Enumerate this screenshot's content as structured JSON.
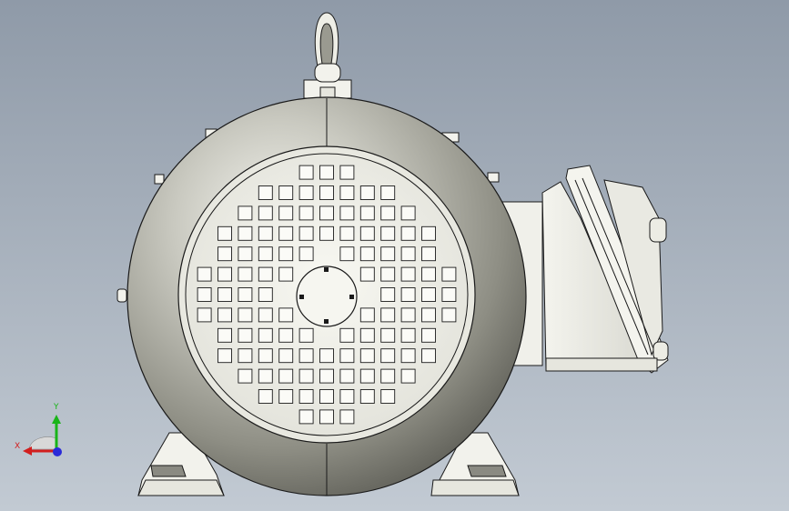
{
  "viewport": {
    "background_top": "#8f9aa8",
    "background_bottom": "#c2cad3"
  },
  "model": {
    "body_color": "#9a9a90",
    "highlight_color": "#e8e8e2",
    "part_color": "#f2f2ec",
    "outline_color": "#1a1a1a"
  },
  "triad": {
    "x_label": "X",
    "y_label": "Y",
    "x_color": "#d21e1e",
    "y_color": "#19b419",
    "z_color": "#2a2ad8"
  }
}
